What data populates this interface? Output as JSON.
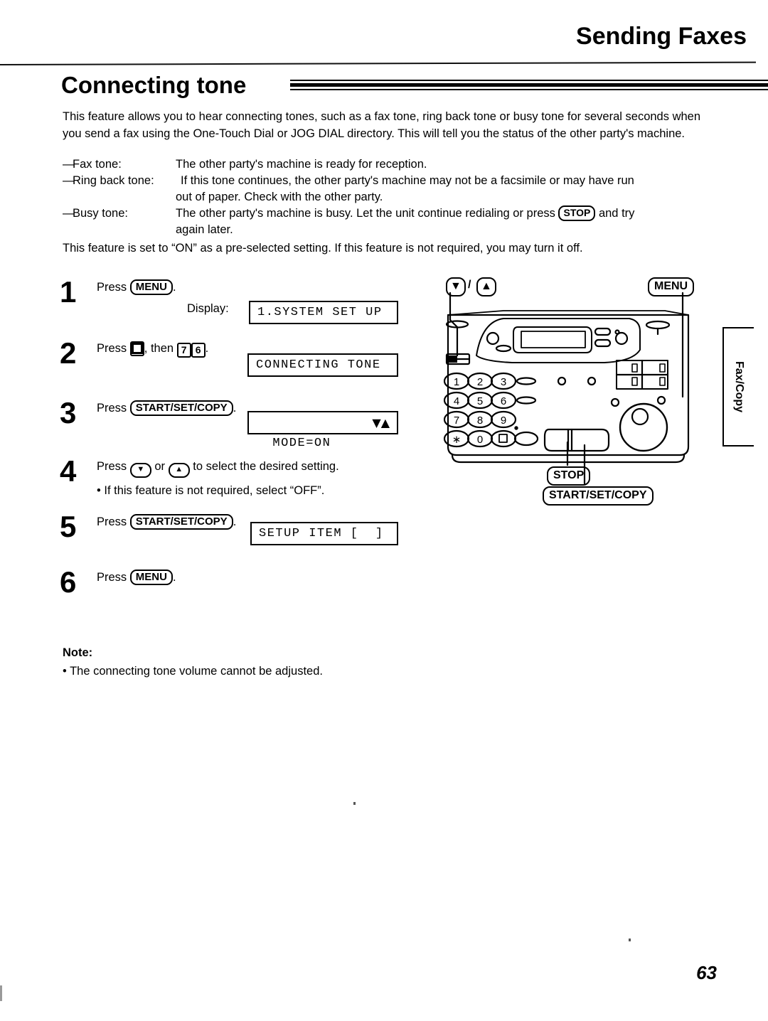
{
  "header": {
    "title": "Sending Faxes"
  },
  "section": {
    "title": "Connecting tone"
  },
  "intro": {
    "paragraph": "This feature allows you to hear connecting tones, such as a fax tone, ring back tone or busy tone for several seconds when you send a fax using the One-Touch Dial or JOG DIAL directory. This will tell you the status of the other party's machine."
  },
  "tones": [
    {
      "dash": "—",
      "label": "Fax tone:",
      "desc": "The other party's machine is ready for reception.",
      "cont": ""
    },
    {
      "dash": "—",
      "label": "Ring back tone:",
      "desc": "If this tone continues, the other party's machine may not be a facsimile or may have run",
      "cont": "out of paper. Check with the other party."
    },
    {
      "dash": "—",
      "label": "Busy tone:",
      "desc_before": "The other party's machine is busy. Let the unit continue redialing or press",
      "key": "STOP",
      "desc_after": "and try",
      "cont": "again later."
    }
  ],
  "preselect": {
    "text": "This feature is set to “ON” as a pre-selected setting. If this feature is not required, you may turn it off."
  },
  "steps": [
    {
      "num": "1",
      "press": "Press",
      "key": "MENU",
      "period": ".",
      "display_label": "Display:",
      "lcd": "1.SYSTEM SET UP"
    },
    {
      "num": "2",
      "press": "Press",
      "key_hash": "#",
      "then": ", then",
      "key_7": "7",
      "key_6": "6",
      "period": ".",
      "lcd": "CONNECTING TONE"
    },
    {
      "num": "3",
      "press": "Press",
      "key": "START/SET/COPY",
      "period": ".",
      "lcd": "MODE=ON",
      "lcd_arrows": "▼▲"
    },
    {
      "num": "4",
      "press": "Press",
      "key_down": "▼",
      "or": "or",
      "key_up": "▲",
      "tail": "to select the desired setting.",
      "bullet": "• If this feature is not required, select “OFF”."
    },
    {
      "num": "5",
      "press": "Press",
      "key": "START/SET/COPY",
      "period": ".",
      "lcd": "SETUP ITEM [  ]"
    },
    {
      "num": "6",
      "press": "Press",
      "key": "MENU",
      "period": "."
    }
  ],
  "device": {
    "callout_navigation": "▼",
    "callout_navigation_sep": "/",
    "callout_navigation_up": "▲",
    "callout_menu": "MENU",
    "callout_stop": "STOP",
    "callout_start": "START/SET/COPY",
    "keypad": [
      "1",
      "2",
      "3",
      "4",
      "5",
      "6",
      "7",
      "8",
      "9",
      "∗",
      "0",
      "□"
    ]
  },
  "side_tab": {
    "label": "Fax/Copy"
  },
  "note": {
    "heading": "Note:",
    "items": [
      "• The connecting tone volume cannot be adjusted."
    ]
  },
  "footer": {
    "page_number": "63"
  }
}
